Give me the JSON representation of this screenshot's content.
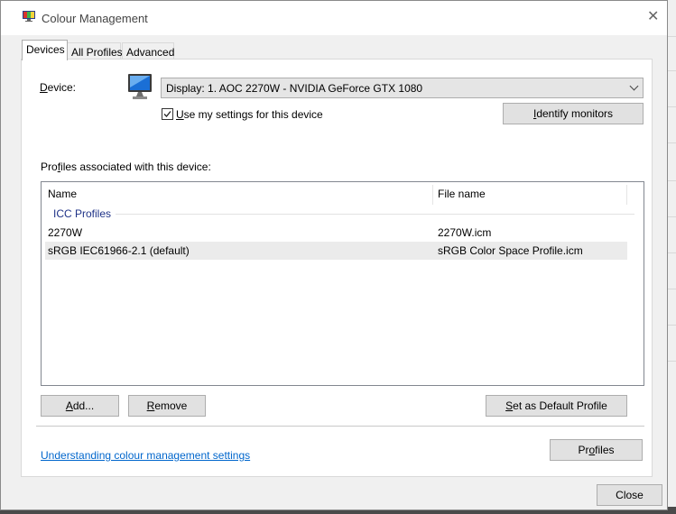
{
  "window": {
    "title": "Colour Management",
    "close_glyph": "✕"
  },
  "tabs": [
    {
      "label": "Devices",
      "active": true
    },
    {
      "label": "All Profiles",
      "active": false
    },
    {
      "label": "Advanced",
      "active": false
    }
  ],
  "device": {
    "label_access": "D",
    "label_rest": "evice:",
    "icon": "monitor-icon",
    "selected": "Display: 1. AOC 2270W - NVIDIA GeForce GTX 1080"
  },
  "use_my_settings": {
    "checked": true,
    "label_access": "U",
    "label_rest": "se my settings for this device"
  },
  "identify_button": {
    "access": "I",
    "rest": "dentify monitors"
  },
  "profiles_section": {
    "label_pre": "Pro",
    "label_access": "f",
    "label_rest": "iles associated with this device:"
  },
  "profile_list": {
    "columns": [
      "Name",
      "File name"
    ],
    "group": "ICC Profiles",
    "rows": [
      {
        "name": "2270W",
        "file": "2270W.icm",
        "selected": false
      },
      {
        "name": "sRGB IEC61966-2.1 (default)",
        "file": "sRGB Color Space Profile.icm",
        "selected": true
      }
    ]
  },
  "buttons": {
    "add": {
      "access": "A",
      "rest": "dd..."
    },
    "remove": {
      "access": "R",
      "rest": "emove"
    },
    "set_default": {
      "access": "S",
      "rest": "et as Default Profile"
    },
    "profiles": {
      "pre": "Pr",
      "access": "o",
      "rest": "files"
    },
    "close": "Close"
  },
  "help_link": "Understanding colour management settings",
  "colors": {
    "link": "#0066cc",
    "group": "#1e3287",
    "button": "#e1e1e1"
  }
}
